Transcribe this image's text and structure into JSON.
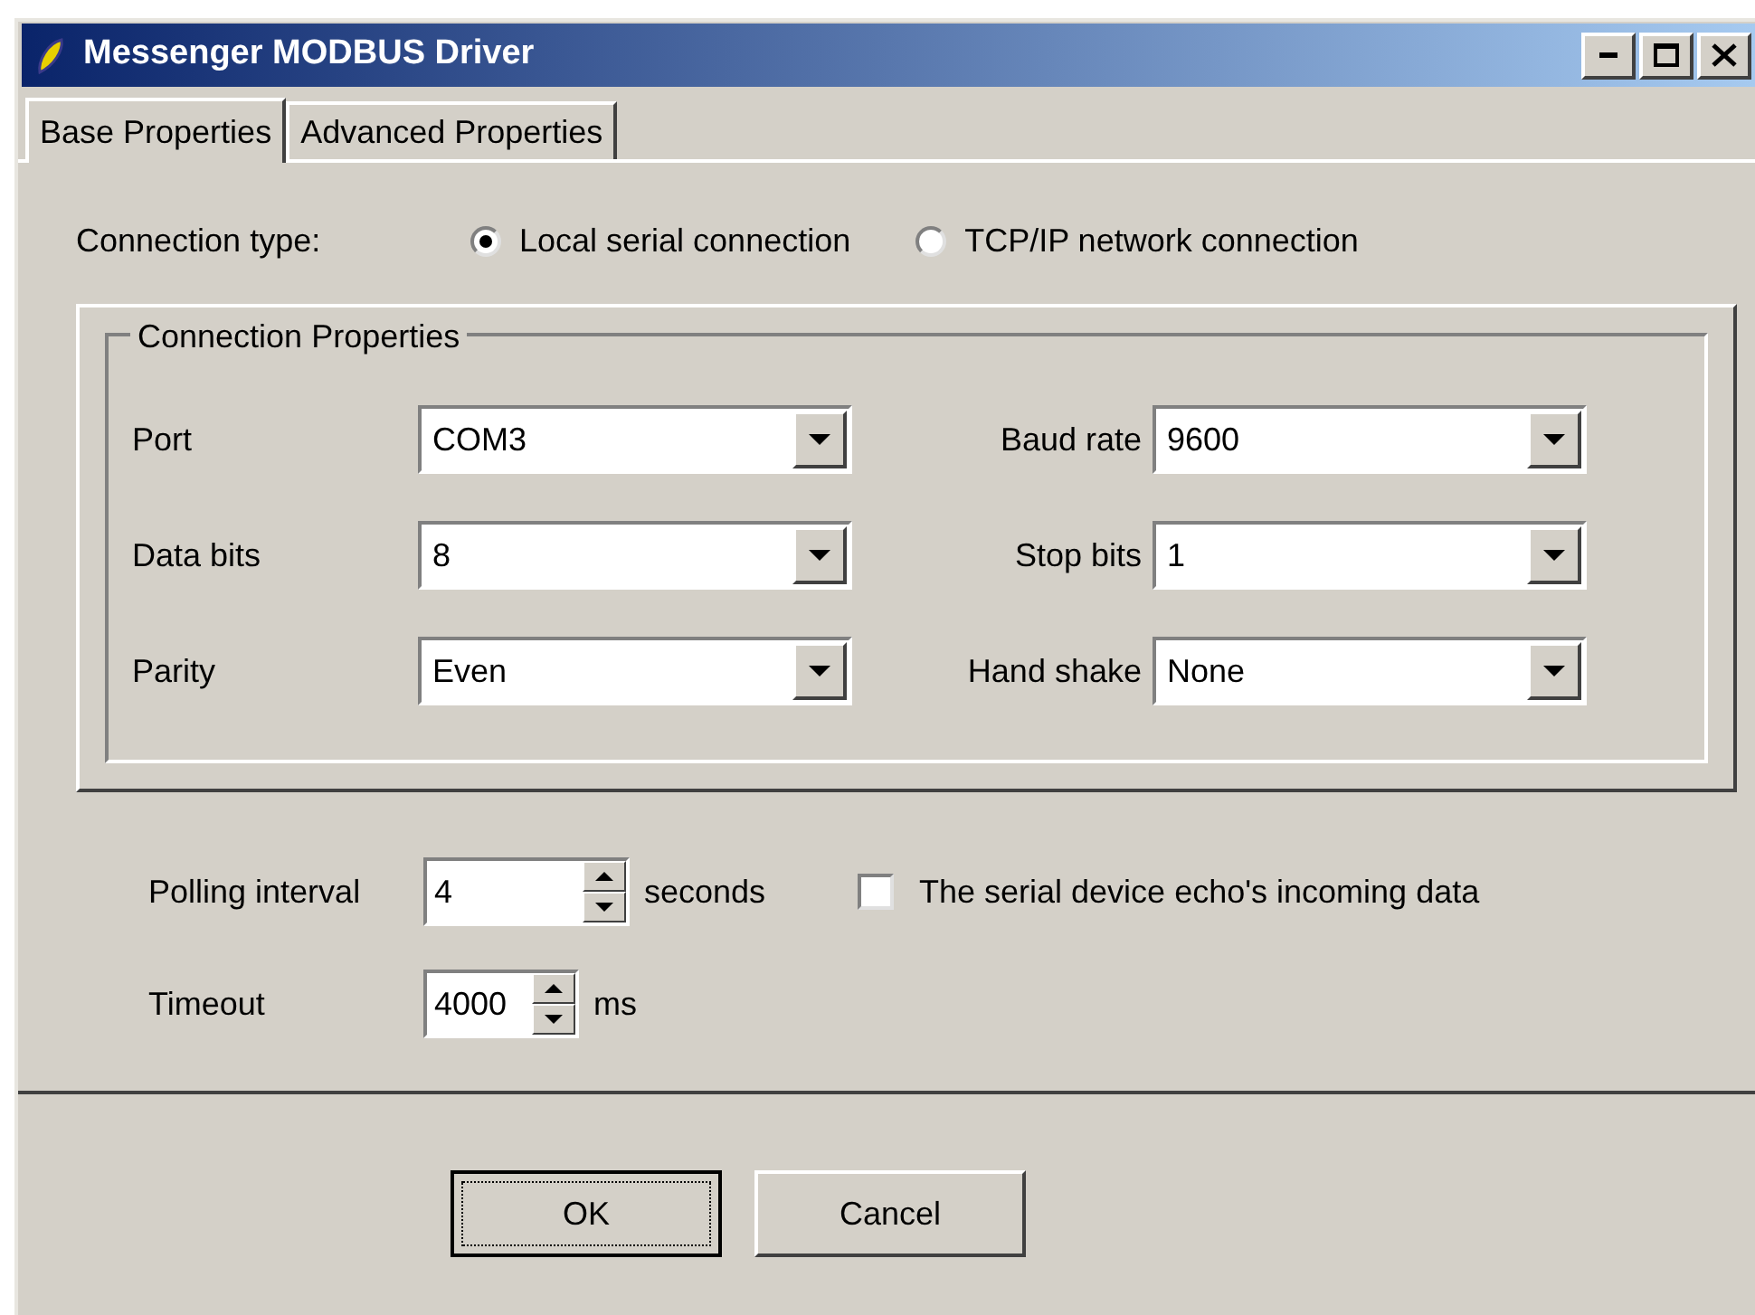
{
  "window": {
    "title": "Messenger MODBUS Driver"
  },
  "tabs": [
    {
      "label": "Base Properties",
      "selected": true
    },
    {
      "label": "Advanced Properties",
      "selected": false
    }
  ],
  "connection_type": {
    "label": "Connection type:",
    "options": [
      {
        "label": "Local serial connection",
        "selected": true
      },
      {
        "label": "TCP/IP network connection",
        "selected": false
      }
    ]
  },
  "connection_properties": {
    "title": "Connection Properties",
    "fields": [
      {
        "label": "Port",
        "value": "COM3"
      },
      {
        "label": "Baud rate",
        "value": "9600"
      },
      {
        "label": "Data bits",
        "value": "8"
      },
      {
        "label": "Stop bits",
        "value": "1"
      },
      {
        "label": "Parity",
        "value": "Even"
      },
      {
        "label": "Hand shake",
        "value": "None"
      }
    ]
  },
  "polling_interval": {
    "label": "Polling interval",
    "value": "4",
    "unit": "seconds"
  },
  "echo_checkbox": {
    "label": "The serial device echo's incoming data",
    "checked": false
  },
  "timeout": {
    "label": "Timeout",
    "value": "4000",
    "unit": "ms"
  },
  "buttons": [
    {
      "label": "OK",
      "default": true
    },
    {
      "label": "Cancel",
      "default": false
    }
  ]
}
